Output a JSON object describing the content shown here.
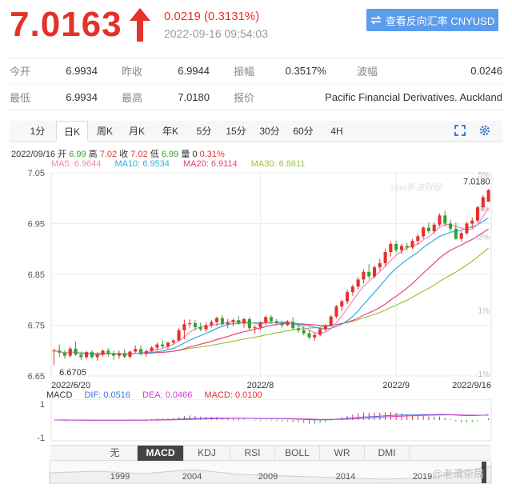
{
  "header": {
    "price": "7.0163",
    "change": "0.0219 (0.3131%)",
    "time": "2022-09-16 09:54:03",
    "reverse_button": "查看反向汇率 CNYUSD",
    "up_color": "#e4312b"
  },
  "stats": {
    "row1": [
      {
        "label": "今开",
        "value": "6.9934"
      },
      {
        "label": "昨收",
        "value": "6.9944"
      },
      {
        "label": "振幅",
        "value": "0.3517%"
      },
      {
        "label": "波幅",
        "value": "0.0246"
      }
    ],
    "row2": [
      {
        "label": "最低",
        "value": "6.9934"
      },
      {
        "label": "最高",
        "value": "7.0180"
      },
      {
        "label": "报价",
        "value": "Pacific Financial Derivatives. Auckland"
      }
    ]
  },
  "tabs": [
    "1分",
    "日K",
    "周K",
    "月K",
    "年K",
    "5分",
    "15分",
    "30分",
    "60分",
    "4H"
  ],
  "active_tab": "日K",
  "info": {
    "date": "2022/09/16",
    "open_label": "开",
    "open": "6.99",
    "high_label": "高",
    "high": "7.02",
    "close_label": "收",
    "close": "7.02",
    "low_label": "低",
    "low": "6.99",
    "vol_label": "量",
    "vol": "0",
    "pct": "0.31%",
    "ma5": "MA5: 6.9644",
    "ma10": "MA10: 6.9534",
    "ma20": "MA20: 6.9114",
    "ma30": "MA30: 6.8611"
  },
  "watermark_logo": "sina新浪财经",
  "macd": {
    "title": "MACD",
    "dif": "DIF: 0.0516",
    "dea": "DEA: 0.0466",
    "macd": "MACD: 0.0100"
  },
  "indicator_tabs": [
    "无",
    "MACD",
    "KDJ",
    "RSI",
    "BOLL",
    "WR",
    "DMI"
  ],
  "active_indicator": "MACD",
  "nav_years": [
    "1999",
    "2004",
    "2009",
    "2014",
    "2019"
  ],
  "author_watermark": "@老渭杂局",
  "chart_data": {
    "type": "candlestick",
    "ylim": [
      6.65,
      7.05
    ],
    "y_ticks": [
      "7.05",
      "6.95",
      "6.85",
      "6.75",
      "6.65"
    ],
    "pct_ticks": [
      "5%",
      "3%",
      "2%",
      "1%",
      "-1%"
    ],
    "x_ticks": [
      "2022/6/20",
      "2022/8",
      "2022/9",
      "2022/9/16"
    ],
    "max_label": "7.0180",
    "min_label": "6.6705",
    "colors": {
      "up": "#e4312b",
      "down": "#2ea52e",
      "ma5": "#f087b8",
      "ma10": "#35a9e0",
      "ma20": "#e8427e",
      "ma30": "#9bc43d"
    },
    "candles": [
      [
        6.699,
        6.704,
        6.671,
        6.7
      ],
      [
        6.7,
        6.712,
        6.688,
        6.696
      ],
      [
        6.696,
        6.701,
        6.684,
        6.69
      ],
      [
        6.69,
        6.708,
        6.686,
        6.704
      ],
      [
        6.704,
        6.718,
        6.69,
        6.692
      ],
      [
        6.692,
        6.698,
        6.682,
        6.687
      ],
      [
        6.687,
        6.7,
        6.683,
        6.697
      ],
      [
        6.697,
        6.701,
        6.684,
        6.687
      ],
      [
        6.687,
        6.697,
        6.68,
        6.692
      ],
      [
        6.692,
        6.702,
        6.688,
        6.7
      ],
      [
        6.7,
        6.705,
        6.688,
        6.694
      ],
      [
        6.694,
        6.7,
        6.682,
        6.69
      ],
      [
        6.69,
        6.7,
        6.684,
        6.695
      ],
      [
        6.695,
        6.702,
        6.685,
        6.688
      ],
      [
        6.688,
        6.7,
        6.684,
        6.698
      ],
      [
        6.698,
        6.71,
        6.695,
        6.703
      ],
      [
        6.703,
        6.71,
        6.69,
        6.694
      ],
      [
        6.694,
        6.703,
        6.688,
        6.699
      ],
      [
        6.699,
        6.709,
        6.697,
        6.706
      ],
      [
        6.706,
        6.716,
        6.7,
        6.712
      ],
      [
        6.712,
        6.72,
        6.705,
        6.708
      ],
      [
        6.708,
        6.717,
        6.703,
        6.716
      ],
      [
        6.716,
        6.722,
        6.712,
        6.72
      ],
      [
        6.72,
        6.744,
        6.718,
        6.74
      ],
      [
        6.74,
        6.761,
        6.722,
        6.752
      ],
      [
        6.752,
        6.761,
        6.745,
        6.754
      ],
      [
        6.754,
        6.76,
        6.74,
        6.746
      ],
      [
        6.746,
        6.755,
        6.738,
        6.742
      ],
      [
        6.742,
        6.756,
        6.737,
        6.75
      ],
      [
        6.75,
        6.76,
        6.745,
        6.756
      ],
      [
        6.756,
        6.767,
        6.748,
        6.764
      ],
      [
        6.764,
        6.77,
        6.749,
        6.752
      ],
      [
        6.752,
        6.762,
        6.744,
        6.756
      ],
      [
        6.756,
        6.763,
        6.748,
        6.76
      ],
      [
        6.76,
        6.768,
        6.751,
        6.754
      ],
      [
        6.754,
        6.765,
        6.745,
        6.762
      ],
      [
        6.762,
        6.766,
        6.74,
        6.744
      ],
      [
        6.744,
        6.75,
        6.733,
        6.746
      ],
      [
        6.746,
        6.758,
        6.741,
        6.755
      ],
      [
        6.755,
        6.769,
        6.75,
        6.766
      ],
      [
        6.766,
        6.77,
        6.754,
        6.758
      ],
      [
        6.758,
        6.762,
        6.75,
        6.754
      ],
      [
        6.754,
        6.758,
        6.745,
        6.75
      ],
      [
        6.75,
        6.76,
        6.748,
        6.757
      ],
      [
        6.757,
        6.766,
        6.74,
        6.744
      ],
      [
        6.744,
        6.752,
        6.735,
        6.74
      ],
      [
        6.74,
        6.748,
        6.73,
        6.734
      ],
      [
        6.734,
        6.741,
        6.722,
        6.726
      ],
      [
        6.726,
        6.735,
        6.72,
        6.731
      ],
      [
        6.731,
        6.745,
        6.728,
        6.742
      ],
      [
        6.742,
        6.752,
        6.738,
        6.749
      ],
      [
        6.749,
        6.77,
        6.747,
        6.767
      ],
      [
        6.767,
        6.79,
        6.764,
        6.787
      ],
      [
        6.787,
        6.8,
        6.778,
        6.797
      ],
      [
        6.797,
        6.82,
        6.792,
        6.815
      ],
      [
        6.815,
        6.83,
        6.808,
        6.826
      ],
      [
        6.826,
        6.845,
        6.82,
        6.84
      ],
      [
        6.84,
        6.86,
        6.832,
        6.855
      ],
      [
        6.855,
        6.87,
        6.84,
        6.846
      ],
      [
        6.846,
        6.868,
        6.842,
        6.864
      ],
      [
        6.864,
        6.88,
        6.858,
        6.872
      ],
      [
        6.872,
        6.9,
        6.866,
        6.894
      ],
      [
        6.894,
        6.915,
        6.885,
        6.91
      ],
      [
        6.91,
        6.916,
        6.893,
        6.898
      ],
      [
        6.898,
        6.91,
        6.89,
        6.906
      ],
      [
        6.906,
        6.912,
        6.897,
        6.903
      ],
      [
        6.903,
        6.92,
        6.9,
        6.916
      ],
      [
        6.916,
        6.93,
        6.908,
        6.925
      ],
      [
        6.925,
        6.945,
        6.92,
        6.942
      ],
      [
        6.942,
        6.952,
        6.93,
        6.935
      ],
      [
        6.935,
        6.952,
        6.93,
        6.948
      ],
      [
        6.948,
        6.97,
        6.945,
        6.966
      ],
      [
        6.966,
        6.975,
        6.944,
        6.95
      ],
      [
        6.95,
        6.958,
        6.935,
        6.94
      ],
      [
        6.94,
        6.952,
        6.918,
        6.92
      ],
      [
        6.92,
        6.935,
        6.915,
        6.931
      ],
      [
        6.931,
        6.954,
        6.928,
        6.95
      ],
      [
        6.95,
        6.962,
        6.94,
        6.956
      ],
      [
        6.956,
        6.985,
        6.952,
        6.982
      ],
      [
        6.982,
        7.006,
        6.975,
        7.002
      ],
      [
        6.993,
        7.018,
        6.993,
        7.016
      ]
    ]
  }
}
